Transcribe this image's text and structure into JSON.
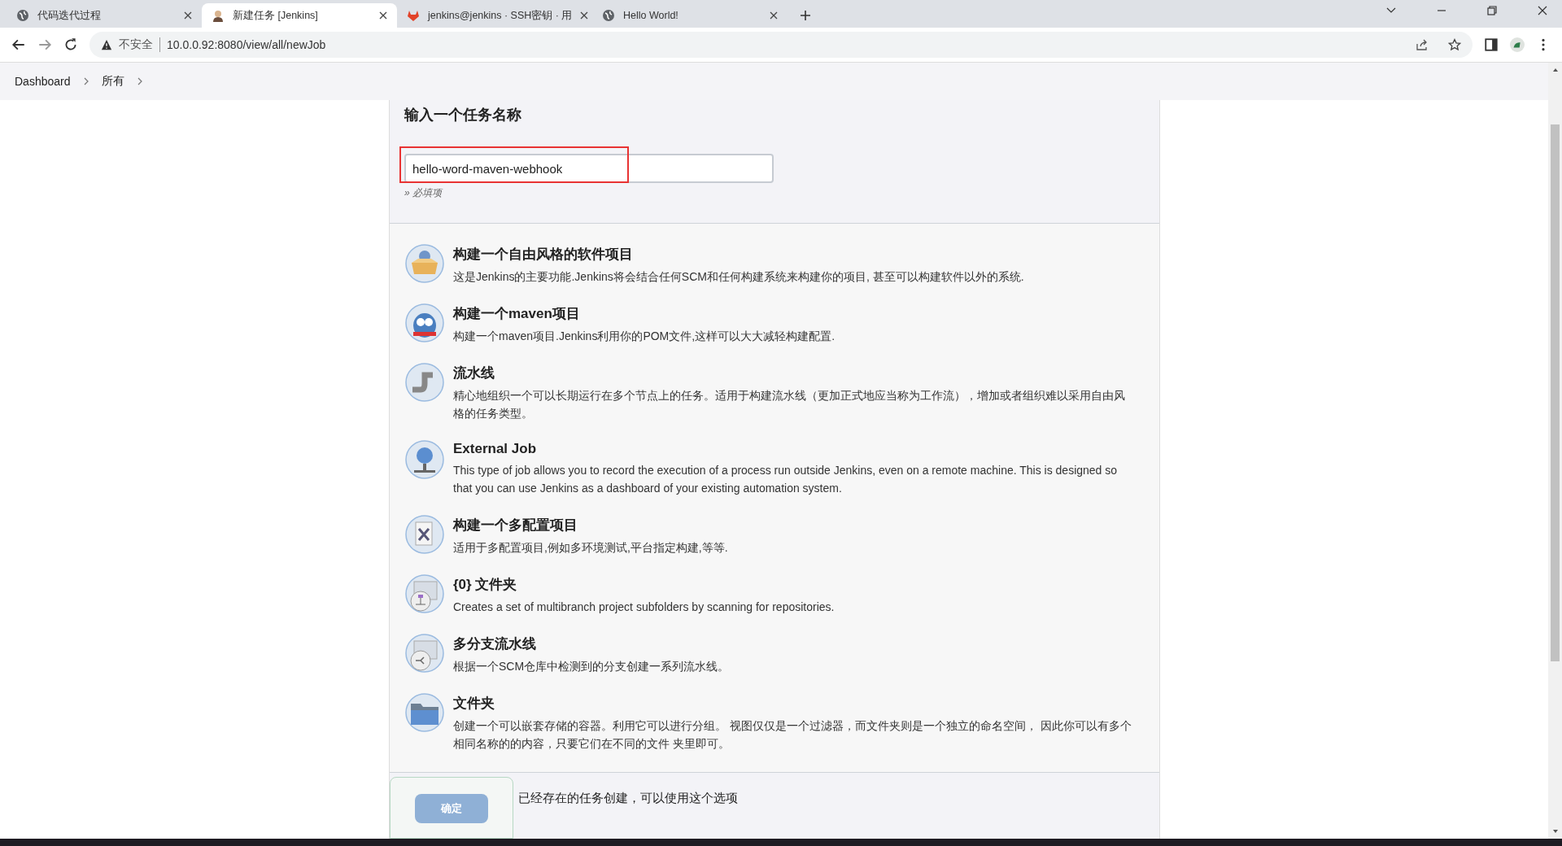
{
  "tabs": [
    {
      "kind": "globe",
      "title": "代码迭代过程",
      "selected": false
    },
    {
      "kind": "jenkins",
      "title": "新建任务 [Jenkins]",
      "selected": true
    },
    {
      "kind": "gitlab",
      "title": "jenkins@jenkins · SSH密钥 · 用",
      "selected": false
    },
    {
      "kind": "globe",
      "title": "Hello World!",
      "selected": false
    }
  ],
  "address_bar": {
    "security": "不安全",
    "url": "10.0.0.92:8080/view/all/newJob"
  },
  "breadcrumbs": [
    "Dashboard",
    "所有"
  ],
  "name_form": {
    "heading": "输入一个任务名称",
    "value": "hello-word-maven-webhook",
    "highlighted": true,
    "hint": "» 必填项"
  },
  "job_types": [
    {
      "kind": "freestyle",
      "title": "构建一个自由风格的软件项目",
      "description": "这是Jenkins的主要功能.Jenkins将会结合任何SCM和任何构建系统来构建你的项目, 甚至可以构建软件以外的系统."
    },
    {
      "kind": "maven",
      "title": "构建一个maven项目",
      "description": "构建一个maven项目.Jenkins利用你的POM文件,这样可以大大减轻构建配置."
    },
    {
      "kind": "pipeline",
      "title": "流水线",
      "description": "精心地组织一个可以长期运行在多个节点上的任务。适用于构建流水线（更加正式地应当称为工作流），增加或者组织难以采用自由风格的任务类型。"
    },
    {
      "kind": "external",
      "title": "External Job",
      "description": "This type of job allows you to record the execution of a process run outside Jenkins, even on a remote machine. This is designed so that you can use Jenkins as a dashboard of your existing automation system."
    },
    {
      "kind": "matrix",
      "title": "构建一个多配置项目",
      "description": "适用于多配置项目,例如多环境测试,平台指定构建,等等."
    },
    {
      "kind": "org-folder",
      "title": "{0} 文件夹",
      "description": "Creates a set of multibranch project subfolders by scanning for repositories."
    },
    {
      "kind": "multibranch",
      "title": "多分支流水线",
      "description": "根据一个SCM仓库中检测到的分支创建一系列流水线。"
    },
    {
      "kind": "folder",
      "title": "文件夹",
      "description": "创建一个可以嵌套存储的容器。利用它可以进行分组。 视图仅仅是一个过滤器，而文件夹则是一个独立的命名空间， 因此你可以有多个相同名称的的内容，只要它们在不同的文件 夹里即可。"
    }
  ],
  "copy_section": {
    "text": "已经存在的任务创建，可以使用这个选项"
  },
  "ok_button": "确定"
}
